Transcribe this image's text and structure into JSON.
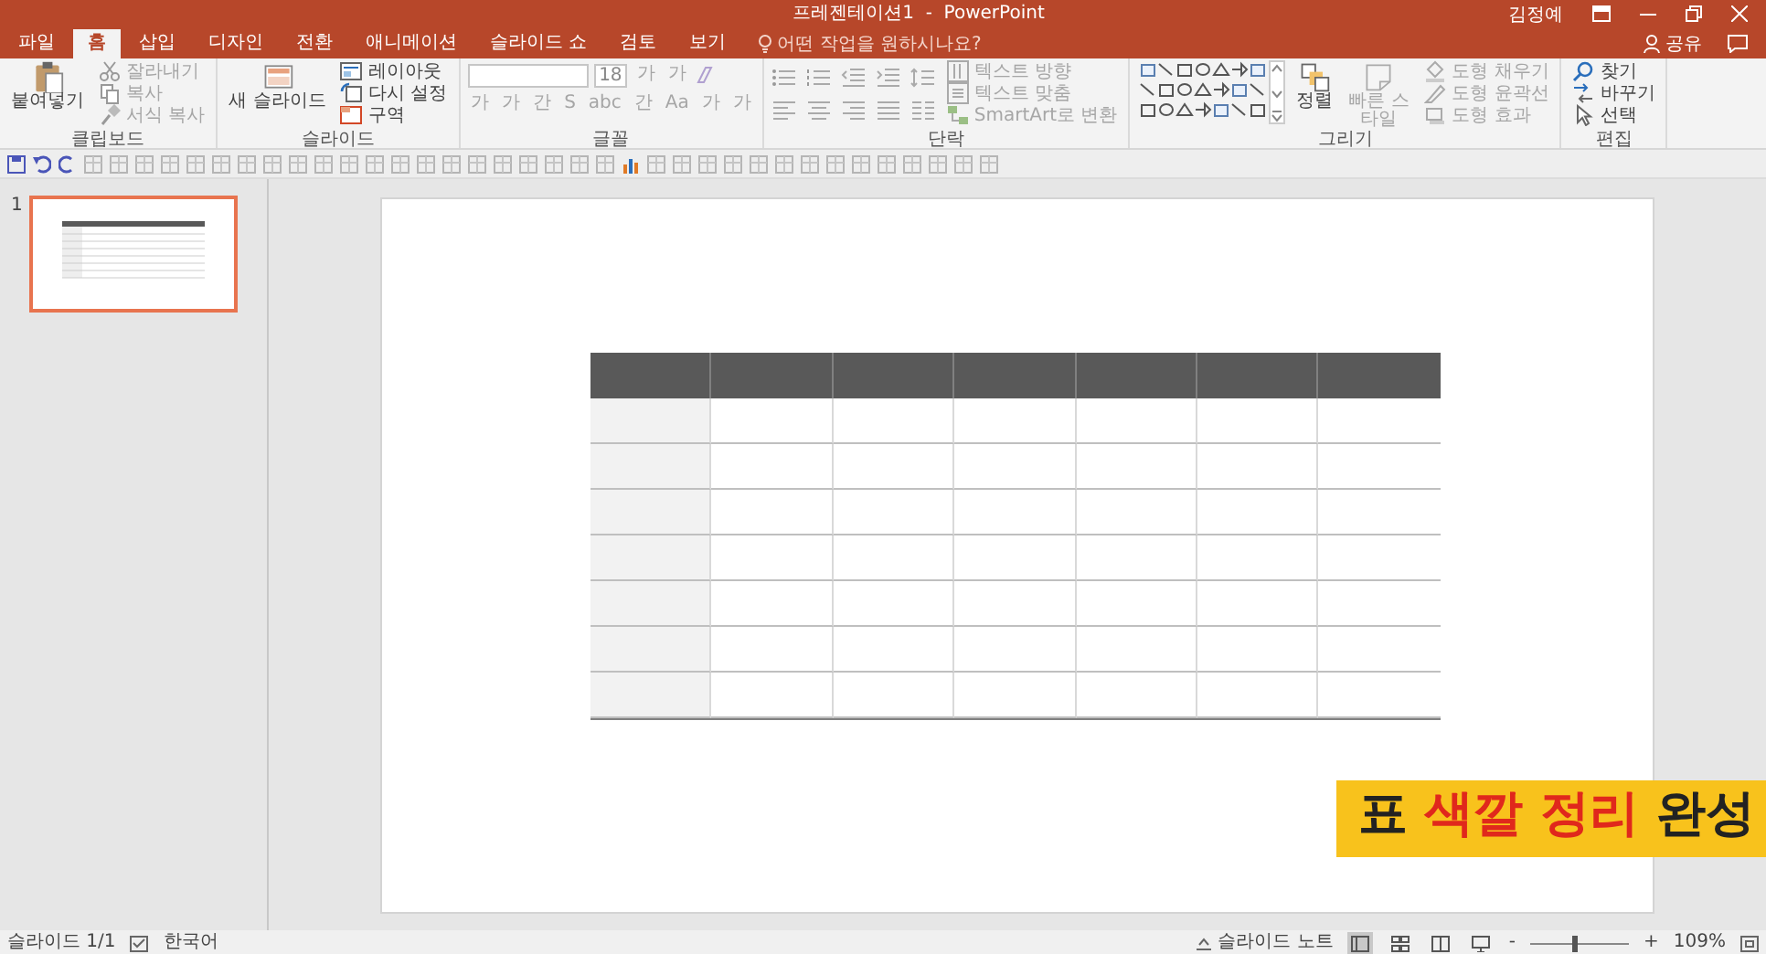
{
  "window": {
    "title": "프레젠테이션1  -  PowerPoint",
    "user": "김정예",
    "share": "공유"
  },
  "tabs": [
    {
      "label": "파일",
      "selected": false
    },
    {
      "label": "홈",
      "selected": true
    },
    {
      "label": "삽입",
      "selected": false
    },
    {
      "label": "디자인",
      "selected": false
    },
    {
      "label": "전환",
      "selected": false
    },
    {
      "label": "애니메이션",
      "selected": false
    },
    {
      "label": "슬라이드 쇼",
      "selected": false
    },
    {
      "label": "검토",
      "selected": false
    },
    {
      "label": "보기",
      "selected": false
    }
  ],
  "tell_me": {
    "placeholder": "어떤 작업을 원하시나요?"
  },
  "ribbon": {
    "groups": [
      {
        "kind": "clipboard",
        "label": "클립보드",
        "items": [
          {
            "kind": "large",
            "label": "붙여넣기",
            "disabled": false
          },
          {
            "kind": "small",
            "label": "잘라내기",
            "disabled": true
          },
          {
            "kind": "small",
            "label": "복사",
            "disabled": true
          },
          {
            "kind": "small",
            "label": "서식 복사",
            "disabled": true
          }
        ]
      },
      {
        "kind": "slides",
        "label": "슬라이드",
        "items": [
          {
            "kind": "large",
            "label": "새 슬라이드",
            "disabled": false
          },
          {
            "kind": "small",
            "label": "레이아웃",
            "disabled": false
          },
          {
            "kind": "small",
            "label": "다시 설정",
            "disabled": false
          },
          {
            "kind": "small",
            "label": "구역",
            "disabled": false
          }
        ]
      },
      {
        "kind": "font",
        "label": "글꼴",
        "size": "18",
        "top_buttons": [
          "가",
          "가"
        ],
        "bottom_buttons": [
          "가",
          "가",
          "간",
          "S",
          "abc",
          "간",
          "Aa",
          "가",
          "가"
        ]
      },
      {
        "kind": "paragraph",
        "label": "단락",
        "items": [
          {
            "kind": "small",
            "label": "텍스트 방향",
            "disabled": true
          },
          {
            "kind": "small",
            "label": "텍스트 맞춤",
            "disabled": true
          },
          {
            "kind": "small",
            "label": "SmartArt로 변환",
            "disabled": true
          }
        ]
      },
      {
        "kind": "drawing",
        "label": "그리기",
        "items": [
          {
            "kind": "gallery"
          },
          {
            "kind": "large",
            "label": "정렬",
            "disabled": false
          },
          {
            "kind": "large",
            "label": "빠른 스타일",
            "disabled": true
          },
          {
            "kind": "small",
            "label": "도형 채우기",
            "disabled": true
          },
          {
            "kind": "small",
            "label": "도형 윤곽선",
            "disabled": true
          },
          {
            "kind": "small",
            "label": "도형 효과",
            "disabled": true
          }
        ]
      },
      {
        "kind": "editing",
        "label": "편집",
        "items": [
          {
            "kind": "small",
            "label": "찾기",
            "disabled": false
          },
          {
            "kind": "small",
            "label": "바꾸기",
            "disabled": false
          },
          {
            "kind": "small",
            "label": "선택",
            "disabled": false
          }
        ]
      }
    ]
  },
  "thumbnails": [
    {
      "number": "1",
      "selected": true
    }
  ],
  "table": {
    "rows": [
      {
        "cells": [
          {
            "kind": "header"
          },
          {
            "kind": "header"
          },
          {
            "kind": "header"
          },
          {
            "kind": "header"
          },
          {
            "kind": "header"
          },
          {
            "kind": "header"
          },
          {
            "kind": "header"
          }
        ]
      },
      {
        "cells": [
          {
            "kind": "stub"
          },
          {
            "kind": "body"
          },
          {
            "kind": "body"
          },
          {
            "kind": "body"
          },
          {
            "kind": "body"
          },
          {
            "kind": "body"
          },
          {
            "kind": "body"
          }
        ]
      },
      {
        "cells": [
          {
            "kind": "stub"
          },
          {
            "kind": "body"
          },
          {
            "kind": "body"
          },
          {
            "kind": "body"
          },
          {
            "kind": "body"
          },
          {
            "kind": "body"
          },
          {
            "kind": "body"
          }
        ]
      },
      {
        "cells": [
          {
            "kind": "stub"
          },
          {
            "kind": "body"
          },
          {
            "kind": "body"
          },
          {
            "kind": "body"
          },
          {
            "kind": "body"
          },
          {
            "kind": "body"
          },
          {
            "kind": "body"
          }
        ]
      },
      {
        "cells": [
          {
            "kind": "stub"
          },
          {
            "kind": "body"
          },
          {
            "kind": "body"
          },
          {
            "kind": "body"
          },
          {
            "kind": "body"
          },
          {
            "kind": "body"
          },
          {
            "kind": "body"
          }
        ]
      },
      {
        "cells": [
          {
            "kind": "stub"
          },
          {
            "kind": "body"
          },
          {
            "kind": "body"
          },
          {
            "kind": "body"
          },
          {
            "kind": "body"
          },
          {
            "kind": "body"
          },
          {
            "kind": "body"
          }
        ]
      },
      {
        "cells": [
          {
            "kind": "stub"
          },
          {
            "kind": "body"
          },
          {
            "kind": "body"
          },
          {
            "kind": "body"
          },
          {
            "kind": "body"
          },
          {
            "kind": "body"
          },
          {
            "kind": "body"
          }
        ]
      },
      {
        "cells": [
          {
            "kind": "stub"
          },
          {
            "kind": "body"
          },
          {
            "kind": "body"
          },
          {
            "kind": "body"
          },
          {
            "kind": "body"
          },
          {
            "kind": "body"
          },
          {
            "kind": "body"
          }
        ]
      }
    ]
  },
  "caption": {
    "parts": [
      {
        "text": "표",
        "highlight": false
      },
      {
        "text": "색깔 정리",
        "highlight": true
      },
      {
        "text": "완성",
        "highlight": false
      }
    ]
  },
  "status_bar": {
    "slide": "슬라이드 1/1",
    "language": "한국어",
    "notes": "슬라이드 노트",
    "zoom_out": "-",
    "zoom_in": "+",
    "zoom": "109%",
    "zoom_level": {
      "level": 0.45
    },
    "views": [
      {
        "kind": "normal",
        "selected": true
      },
      {
        "kind": "sorter",
        "selected": false
      },
      {
        "kind": "reading",
        "selected": false
      },
      {
        "kind": "show",
        "selected": false
      }
    ]
  }
}
